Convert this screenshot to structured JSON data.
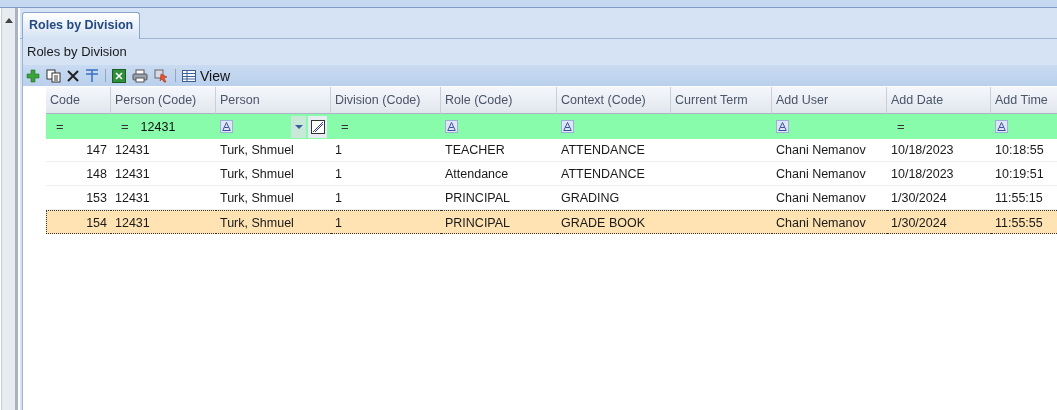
{
  "tabs": [
    {
      "label": "Roles by Division",
      "selected": true
    }
  ],
  "panel": {
    "title": "Roles by Division"
  },
  "toolbar": {
    "view_label": "View"
  },
  "table": {
    "columns": [
      "Code",
      "Person (Code)",
      "Person",
      "Division (Code)",
      "Role (Code)",
      "Context (Code)",
      "Current Term",
      "Add User",
      "Add Date",
      "Add Time"
    ],
    "filters": [
      {
        "kind": "equals",
        "operator": "="
      },
      {
        "kind": "equals",
        "operator": "=",
        "value": "12431"
      },
      {
        "kind": "like",
        "dropdown": true
      },
      {
        "kind": "equals",
        "operator": "="
      },
      {
        "kind": "like"
      },
      {
        "kind": "like"
      },
      {
        "kind": "none"
      },
      {
        "kind": "like"
      },
      {
        "kind": "equals",
        "operator": "="
      },
      {
        "kind": "like"
      }
    ],
    "rows": [
      {
        "selected": false,
        "cells": [
          "147",
          "12431",
          "Turk, Shmuel",
          "1",
          "TEACHER",
          "ATTENDANCE",
          "",
          "Chani Nemanov",
          "10/18/2023",
          "10:18:55"
        ]
      },
      {
        "selected": false,
        "cells": [
          "148",
          "12431",
          "Turk, Shmuel",
          "1",
          "Attendance",
          "ATTENDANCE",
          "",
          "Chani Nemanov",
          "10/18/2023",
          "10:19:51"
        ]
      },
      {
        "selected": false,
        "cells": [
          "153",
          "12431",
          "Turk, Shmuel",
          "1",
          "PRINCIPAL",
          "GRADING",
          "",
          "Chani Nemanov",
          "1/30/2024",
          "11:55:15"
        ]
      },
      {
        "selected": true,
        "cells": [
          "154",
          "12431",
          "Turk, Shmuel",
          "1",
          "PRINCIPAL",
          "GRADE BOOK",
          "",
          "Chani Nemanov",
          "1/30/2024",
          "11:55:55"
        ]
      }
    ]
  }
}
